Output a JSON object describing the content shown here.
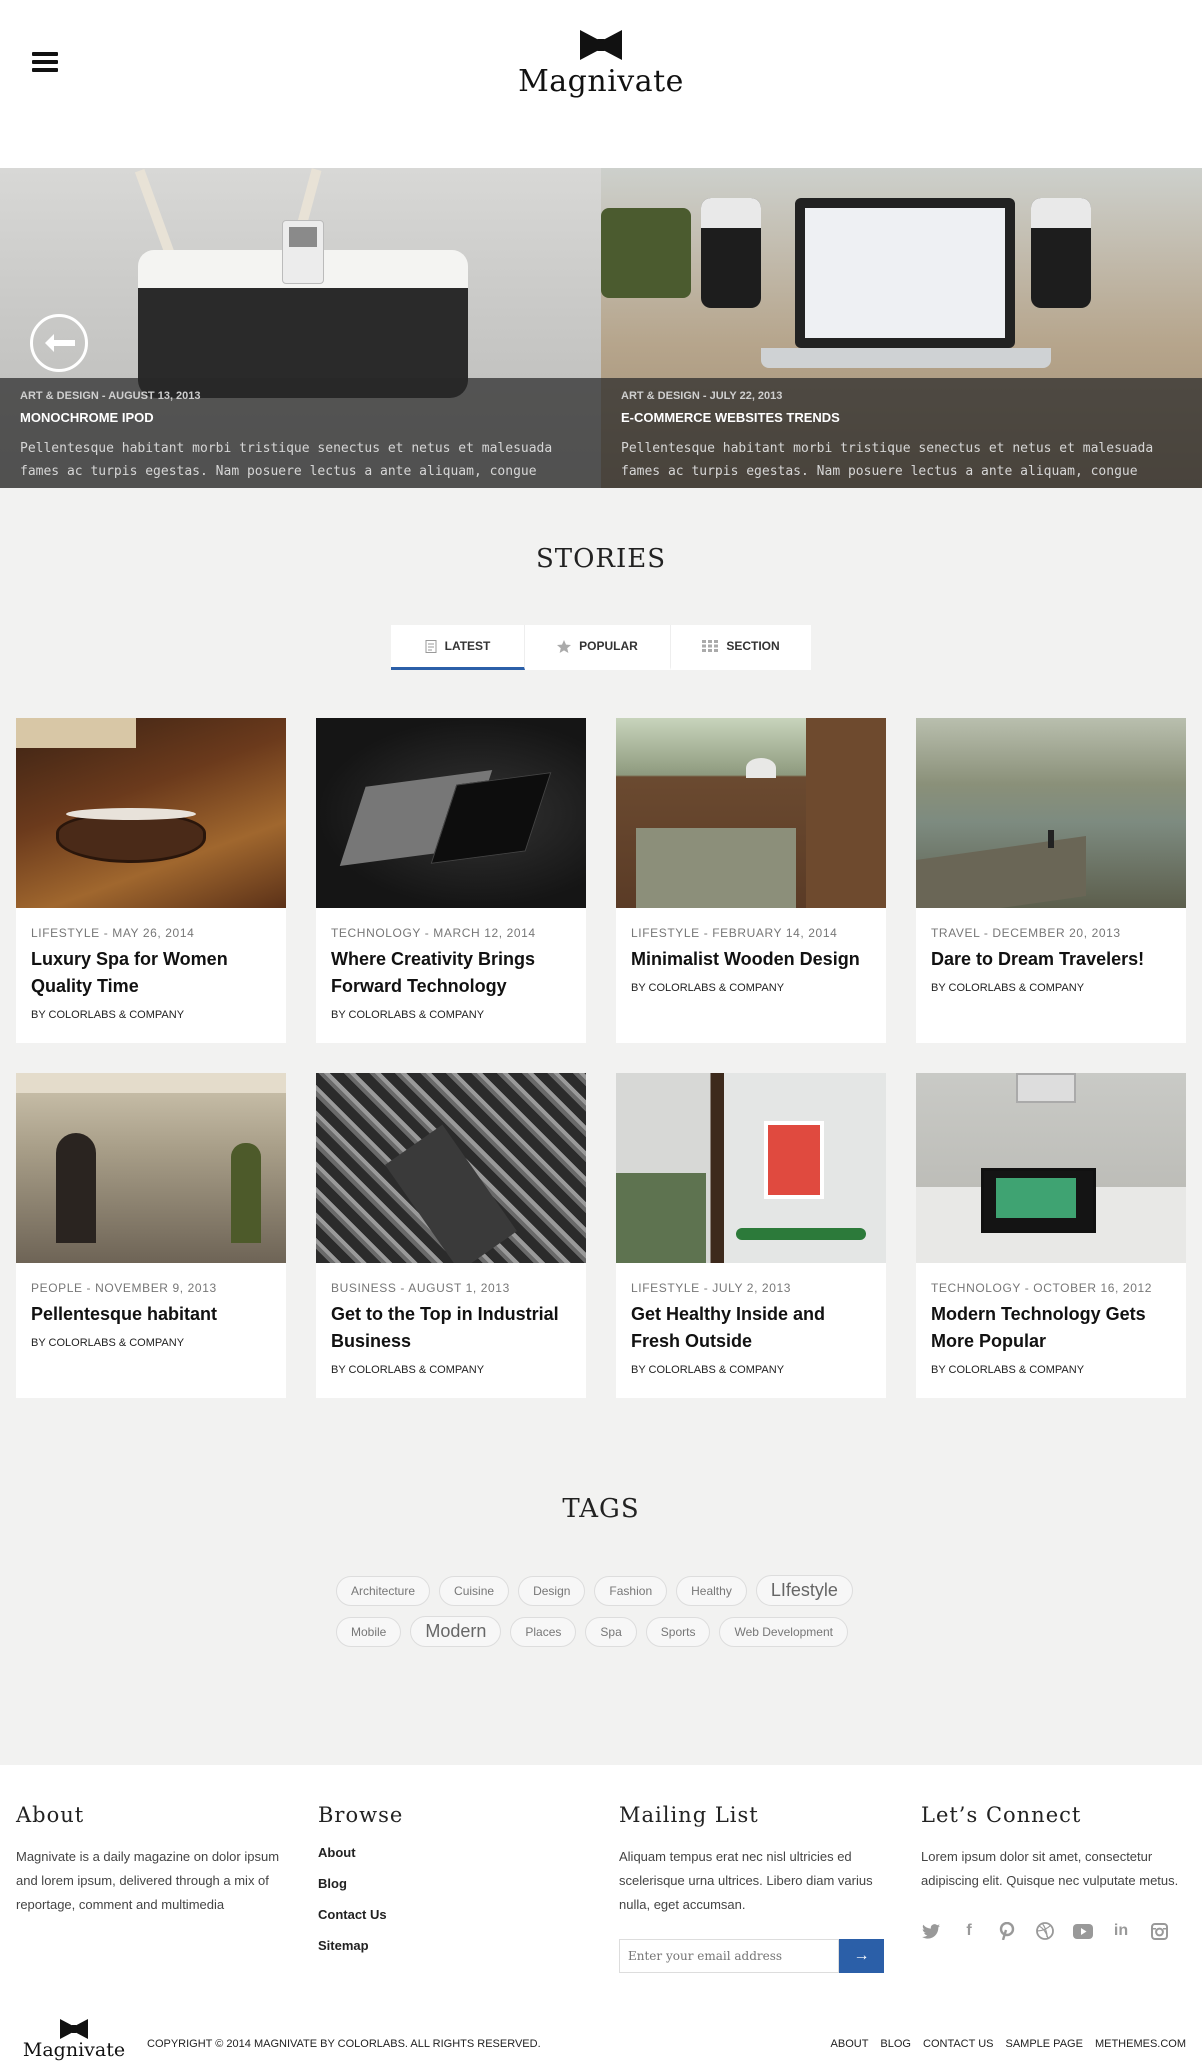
{
  "header": {
    "logo_text": "Magnivate",
    "menu_icon": "hamburger-icon",
    "logo_icon": "bowtie-icon"
  },
  "slider": {
    "prev_icon": "arrow-left-icon",
    "slides": [
      {
        "meta": "ART & DESIGN - AUGUST 13, 2013",
        "title": "MONOCHROME IPOD",
        "excerpt_line1": "Pellentesque habitant morbi tristique senectus et netus et malesuada",
        "excerpt_line2": "fames ac turpis egestas. Nam posuere lectus a ante aliquam, congue"
      },
      {
        "meta": "ART & DESIGN - JULY 22, 2013",
        "title": "E-COMMERCE WEBSITES TRENDS",
        "excerpt_line1": "Pellentesque habitant morbi tristique senectus et netus et malesuada",
        "excerpt_line2": "fames ac turpis egestas. Nam posuere lectus a ante aliquam, congue"
      }
    ]
  },
  "stories": {
    "heading": "STORIES",
    "tabs": [
      {
        "label": "LATEST",
        "icon": "document-icon",
        "active": true
      },
      {
        "label": "POPULAR",
        "icon": "star-icon",
        "active": false
      },
      {
        "label": "SECTION",
        "icon": "grid-icon",
        "active": false
      }
    ],
    "cards": [
      {
        "meta": "LIFESTYLE - MAY 26, 2014",
        "title": "Luxury Spa for Women Quality Time",
        "author_prefix": "BY",
        "author": "COLORLABS & COMPANY"
      },
      {
        "meta": "TECHNOLOGY - MARCH 12, 2014",
        "title": "Where Creativity Brings Forward Technology",
        "author_prefix": "BY",
        "author": "COLORLABS & COMPANY"
      },
      {
        "meta": "LIFESTYLE - FEBRUARY 14, 2014",
        "title": "Minimalist Wooden Design",
        "author_prefix": "BY",
        "author": "COLORLABS & COMPANY"
      },
      {
        "meta": "TRAVEL - DECEMBER 20, 2013",
        "title": "Dare to Dream Travelers!",
        "author_prefix": "BY",
        "author": "COLORLABS & COMPANY"
      },
      {
        "meta": "PEOPLE - NOVEMBER 9, 2013",
        "title": "Pellentesque habitant",
        "author_prefix": "BY",
        "author": "COLORLABS & COMPANY"
      },
      {
        "meta": "BUSINESS - AUGUST 1, 2013",
        "title": "Get to the Top in Industrial Business",
        "author_prefix": "BY",
        "author": "COLORLABS & COMPANY"
      },
      {
        "meta": "LIFESTYLE - JULY 2, 2013",
        "title": "Get Healthy Inside and Fresh Outside",
        "author_prefix": "BY",
        "author": "COLORLABS & COMPANY"
      },
      {
        "meta": "TECHNOLOGY - OCTOBER 16, 2012",
        "title": "Modern Technology Gets More Popular",
        "author_prefix": "BY",
        "author": "COLORLABS & COMPANY"
      }
    ]
  },
  "tags": {
    "heading": "TAGS",
    "row1": [
      "Architecture",
      "Cuisine",
      "Design",
      "Fashion",
      "Healthy",
      "LIfestyle"
    ],
    "row2": [
      "Mobile",
      "Modern",
      "Places",
      "Spa",
      "Sports",
      "Web Development"
    ]
  },
  "footer": {
    "about": {
      "heading": "About",
      "text": "Magnivate is a daily magazine on dolor ipsum and lorem ipsum, delivered through a mix of reportage, comment and multimedia"
    },
    "browse": {
      "heading": "Browse",
      "links": [
        "About",
        "Blog",
        "Contact Us",
        "Sitemap"
      ]
    },
    "mailing": {
      "heading": "Mailing List",
      "text": "Aliquam tempus erat nec nisl ultricies ed scelerisque urna ultrices. Libero diam varius nulla, eget accumsan.",
      "placeholder": "Enter your email address",
      "submit_icon": "arrow-right-icon",
      "submit_label": "→"
    },
    "connect": {
      "heading": "Let’s Connect",
      "text": "Lorem ipsum dolor sit amet, consectetur adipiscing elit. Quisque nec vulputate metus.",
      "social": [
        "twitter-icon",
        "facebook-icon",
        "pinterest-icon",
        "dribbble-icon",
        "youtube-icon",
        "linkedin-icon",
        "instagram-icon"
      ]
    },
    "bottom_logo": "Magnivate",
    "copyright": "COPYRIGHT © 2014 MAGNIVATE BY COLORLABS. ALL RIGHTS RESERVED.",
    "bottom_links": [
      "ABOUT",
      "BLOG",
      "CONTACT US",
      "SAMPLE PAGE",
      "METHEMES.COM"
    ]
  },
  "colors": {
    "accent": "#2b5fa8",
    "page_bg": "#f2f2f1"
  }
}
